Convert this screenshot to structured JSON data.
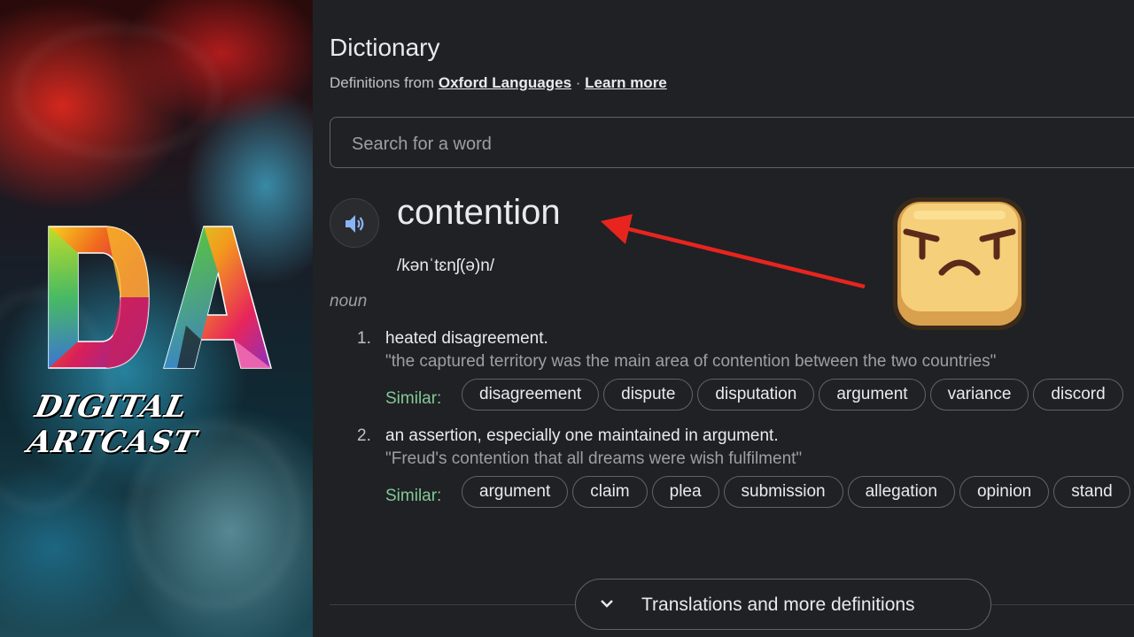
{
  "branding": {
    "logo_letters": "DA",
    "caption": "DIGITAL ARTCAST"
  },
  "dictionary": {
    "title": "Dictionary",
    "source_prefix": "Definitions from",
    "source_link": "Oxford Languages",
    "separator": "·",
    "learn_more": "Learn more",
    "search_placeholder": "Search for a word",
    "word": "contention",
    "pronunciation": "/kənˈtɛnʃ(ə)n/",
    "part_of_speech": "noun",
    "senses": [
      {
        "number": "1.",
        "definition": "heated disagreement.",
        "example": "\"the captured territory was the main area of contention between the two countries\"",
        "similar_label": "Similar:",
        "similar": [
          "disagreement",
          "dispute",
          "disputation",
          "argument",
          "variance",
          "discord"
        ]
      },
      {
        "number": "2.",
        "definition": "an assertion, especially one maintained in argument.",
        "example": "\"Freud's contention that all dreams were wish fulfilment\"",
        "similar_label": "Similar:",
        "similar": [
          "argument",
          "claim",
          "plea",
          "submission",
          "allegation",
          "opinion",
          "stand"
        ]
      }
    ],
    "more_button": "Translations and more definitions"
  },
  "overlay": {
    "emoji": "frustrated-face-icon",
    "arrow_color": "#e8241f"
  },
  "colors": {
    "background": "#202124",
    "text": "#e8eaed",
    "muted": "#9aa0a6",
    "similar_label": "#81c995",
    "border": "#5f6368"
  }
}
